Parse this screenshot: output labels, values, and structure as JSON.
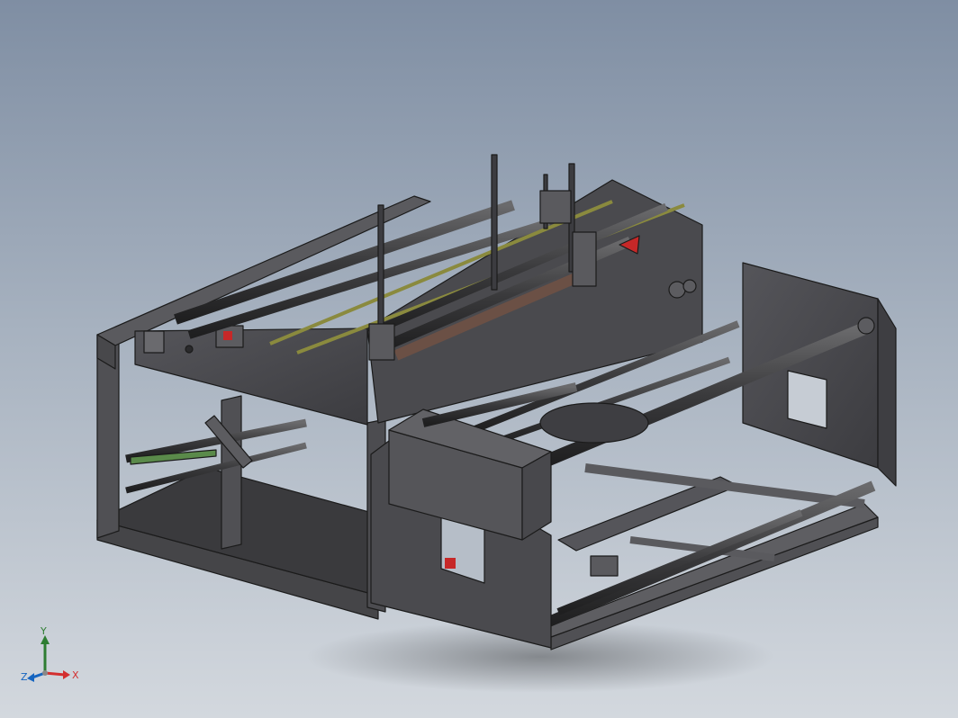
{
  "viewport": {
    "background_top": "#7f8ea3",
    "background_bottom": "#d3d8de",
    "part_color": "#4a4a4c",
    "part_edge_color": "#1b1b1b",
    "rod_color": "#3c3c3e",
    "brass_rod_color": "#8a8a3e",
    "accent_red": "#c62828",
    "accent_green": "#5a8a4a"
  },
  "triad": {
    "x_label": "X",
    "y_label": "Y",
    "z_label": "Z",
    "x_color": "#d32f2f",
    "y_color": "#2e7d32",
    "z_color": "#1565c0"
  }
}
